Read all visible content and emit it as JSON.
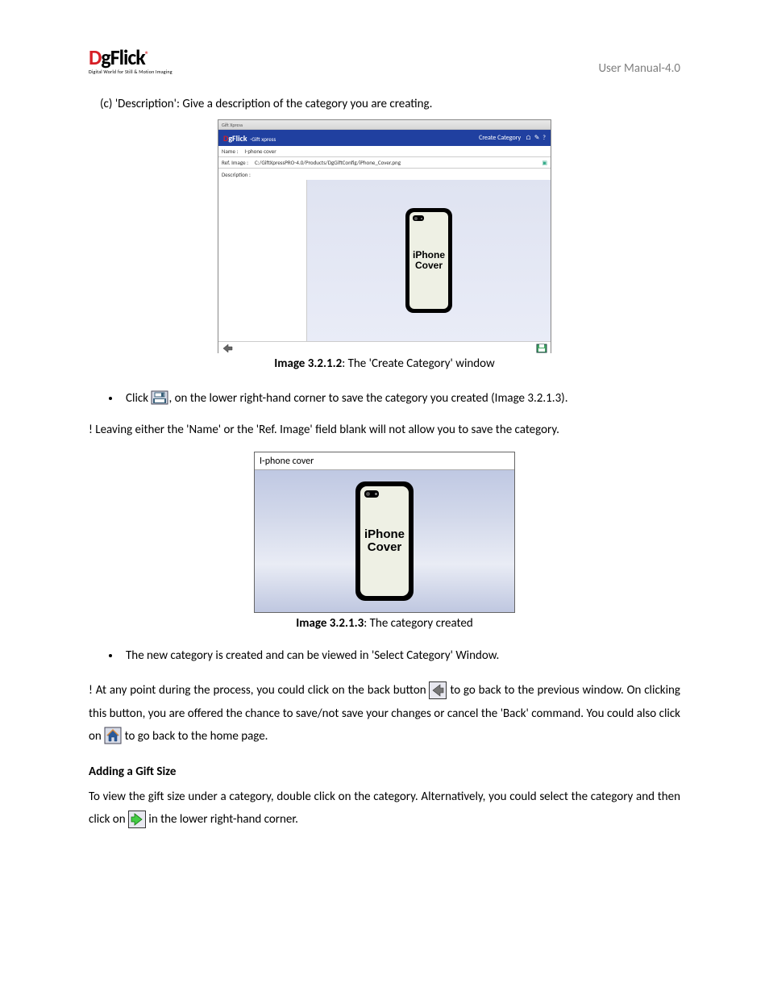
{
  "header": {
    "logo_main": "DgFlick",
    "logo_sub": "Digital World for Still & Motion Imaging",
    "right": "User Manual-4.0"
  },
  "para_c": "(c) 'Description': Give a description of the category you are creating.",
  "fig1": {
    "titlebar": "Gift Xpress",
    "brand": "DgFlick",
    "brand_sub": "-Gift xpress",
    "right_label": "Create Category",
    "name_lbl": "Name :",
    "name_val": "I-phone cover",
    "ref_lbl": "Ref. Image :",
    "ref_val": "C:/GiftXpressPRO-4.0/Products/DgGiftConfig/iPhone_Cover.png",
    "desc_lbl": "Description :",
    "phone_line1": "iPhone",
    "phone_line2": "Cover"
  },
  "caption1_bold": "Image 3.2.1.2",
  "caption1_rest": ": The 'Create Category' window",
  "bullet1_a": "Click",
  "bullet1_b": ", on the lower right-hand corner to save the category you created (Image 3.2.1.3).",
  "warn1": "! Leaving either the 'Name' or the 'Ref. Image' field blank will not allow you to save the category.",
  "fig2": {
    "top": "I-phone cover",
    "phone_line1": "iPhone",
    "phone_line2": "Cover"
  },
  "caption2_bold": "Image 3.2.1.3",
  "caption2_rest": ": The category created",
  "bullet2": "The new category is created and can be viewed in 'Select Category' Window.",
  "para_back_a": "! At any point during the process, you could click on the back button ",
  "para_back_b": " to go back to the previous window. On clicking this button, you are offered the chance to save/not save your changes or cancel the 'Back' command. You could also click on ",
  "para_back_c": " to go back to the home page.",
  "section_h": "Adding a Gift Size",
  "para_gift_a": "To view the gift size under a category, double click on the category. Alternatively, you could select the category and then click on ",
  "para_gift_b": " in the lower right-hand corner."
}
